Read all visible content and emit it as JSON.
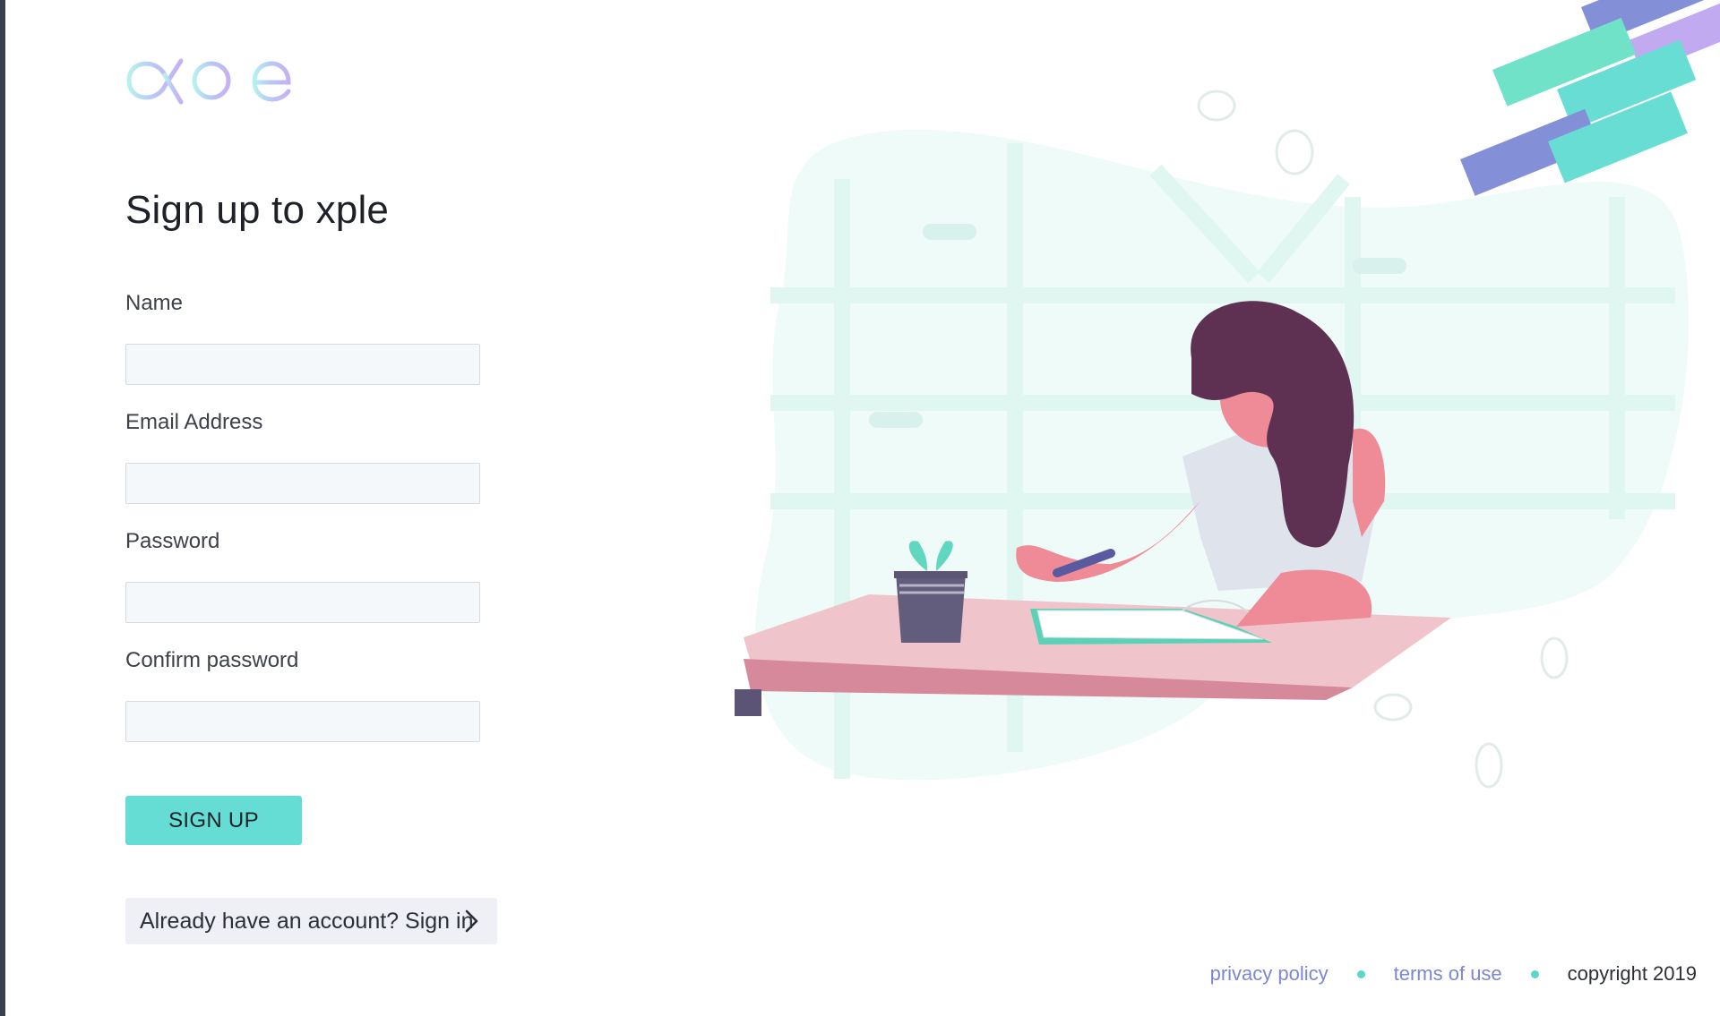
{
  "brand": {
    "logo_text": "xple",
    "colors": {
      "accent": "#66ddd4",
      "link": "#7d86d4",
      "dot": "#5ad7c6",
      "input_bg": "#f5f8fb"
    }
  },
  "form": {
    "title": "Sign up to xple",
    "fields": [
      {
        "label": "Name",
        "value": "",
        "placeholder": ""
      },
      {
        "label": "Email Address",
        "value": "",
        "placeholder": ""
      },
      {
        "label": "Password",
        "value": "",
        "placeholder": ""
      },
      {
        "label": "Confirm password",
        "value": "",
        "placeholder": ""
      }
    ],
    "submit_label": "SIGN UP",
    "signin_text": "Already have an account? Sign in",
    "signin_icon": "chevron-right-icon"
  },
  "footer": {
    "privacy": "privacy policy",
    "terms": "terms of use",
    "copyright": "copyright 2019"
  },
  "illustration": {
    "subject": "woman-writing-at-desk-illustration"
  }
}
